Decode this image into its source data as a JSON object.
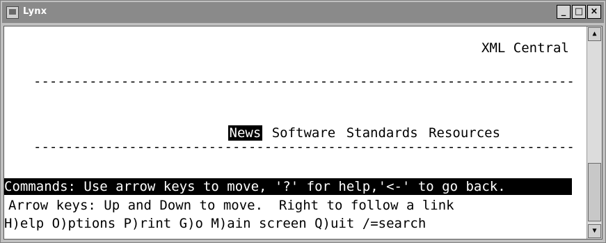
{
  "window": {
    "title": "Lynx",
    "controls": {
      "minimize": "_",
      "maximize": "□",
      "close": "×"
    }
  },
  "page": {
    "site_title": "XML Central",
    "rule_top": "--------------------------------------------------------------------",
    "nav_links": [
      "News",
      "Software",
      "Standards",
      "Resources"
    ],
    "active_link": "News",
    "rule_bottom": "--------------------------------------------------------------------"
  },
  "status": {
    "commands_line": "Commands: Use arrow keys to move, '?' for help,'<-' to go back.",
    "help_line_1": "Arrow keys: Up and Down to move.  Right to follow a link",
    "help_line_2": "H)elp O)ptions P)rint G)o M)ain screen Q)uit /=search"
  },
  "icons": {
    "app": "lynx-app-icon",
    "scroll_up": "arrow-up-icon",
    "scroll_down": "arrow-down-icon"
  }
}
